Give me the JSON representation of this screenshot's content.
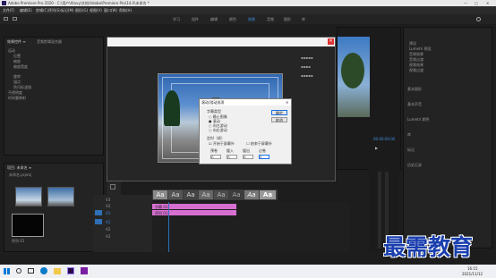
{
  "window": {
    "title": "Adobe Premiere Pro 2020 - C:\\用户\\Alavy\\文档\\Adobe\\Premiere Pro\\14.0\\未命名 *",
    "controls": [
      "—",
      "□",
      "✕"
    ]
  },
  "menubar": [
    "文件(F)",
    "编辑(E)",
    "剪辑(C)",
    "序列(S)",
    "标记(M)",
    "图形(G)",
    "视图(V)",
    "窗口(W)",
    "帮助(H)"
  ],
  "workspaces": [
    "学习",
    "组件",
    "编辑",
    "颜色",
    "效果",
    "音频",
    "图形",
    "库"
  ],
  "workspaces_active": 4,
  "effect_controls": {
    "tabs": [
      "效果控件 ≡",
      "音频剪辑混合器"
    ],
    "rows": [
      "运动",
      "位置",
      "缩放",
      "缩放宽度",
      "旋转",
      "锚点",
      "防闪烁滤镜",
      "不透明度",
      "时间重映射"
    ]
  },
  "project": {
    "tabs": [
      "项目: 未命名 ≡",
      "媒体浏览器"
    ],
    "file": "未命名.prproj",
    "clips": [
      "",
      "",
      "序列 01"
    ]
  },
  "effects_panel": {
    "items": [
      "预设",
      "Lumetri 预设",
      "音频效果",
      "音频过渡",
      "视频效果",
      "视频过渡"
    ],
    "sections": [
      "基本图形",
      "基本声音",
      "Lumetri 颜色",
      "库",
      "标记",
      "历史记录"
    ]
  },
  "program_monitor": {
    "timecode": "00:00:00:00"
  },
  "text_panel": {
    "title": "基本图形",
    "rows": [
      "字幕类型",
      "滚动",
      "游动",
      "静止"
    ]
  },
  "styles_bar": [
    "Aa",
    "Aa",
    "Aa",
    "Aa",
    "Aa",
    "Aa",
    "Aa",
    "Aa"
  ],
  "timeline": {
    "tracks": [
      "V3",
      "V2",
      "V1",
      "A1",
      "A2",
      "A3"
    ],
    "clip_labels": [
      "序列 01",
      "字幕 01"
    ]
  },
  "dialog": {
    "title": "滚动/游动选项",
    "section_type": "字幕类型",
    "types": [
      "静止图像",
      "滚动",
      "向左游动",
      "向右游动"
    ],
    "selected_type": 1,
    "timing_label": "定时（帧）",
    "checks": [
      "开始于屏幕外",
      "结束于屏幕外"
    ],
    "fields": [
      "预卷",
      "缓入",
      "缓出",
      "过卷"
    ],
    "values": [
      "0",
      "0",
      "0",
      "0"
    ],
    "ok": "确定",
    "cancel": "取消"
  },
  "taskbar": {
    "time": "16:15",
    "date": "2021/11/12"
  },
  "watermark": "最需教育"
}
